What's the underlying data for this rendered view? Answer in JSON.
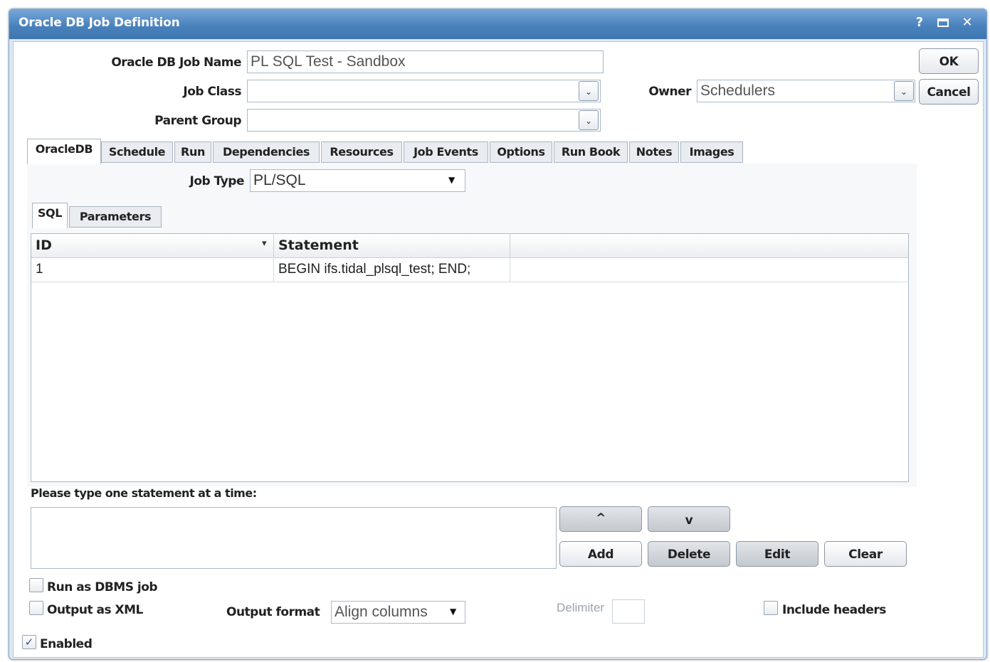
{
  "window": {
    "title": "Oracle DB Job Definition",
    "help_glyph": "?",
    "restore_glyph": "◘",
    "close_glyph": "✕"
  },
  "header": {
    "job_name_label": "Oracle DB Job Name",
    "job_name_value": "PL SQL Test - Sandbox",
    "job_class_label": "Job Class",
    "job_class_value": "",
    "parent_group_label": "Parent Group",
    "parent_group_value": "",
    "owner_label": "Owner",
    "owner_value": "Schedulers",
    "ok_label": "OK",
    "cancel_label": "Cancel",
    "dropdown_glyph": "⌄"
  },
  "tabs": [
    {
      "label": "OracleDB",
      "active": true
    },
    {
      "label": "Schedule"
    },
    {
      "label": "Run"
    },
    {
      "label": "Dependencies"
    },
    {
      "label": "Resources"
    },
    {
      "label": "Job Events"
    },
    {
      "label": "Options"
    },
    {
      "label": "Run Book"
    },
    {
      "label": "Notes"
    },
    {
      "label": "Images"
    }
  ],
  "oracle_tab": {
    "job_type_label": "Job Type",
    "job_type_value": "PL/SQL",
    "select_arrow": "▼",
    "subtabs": [
      {
        "label": "SQL",
        "active": true
      },
      {
        "label": "Parameters"
      }
    ],
    "grid": {
      "columns": [
        "ID",
        "Statement",
        ""
      ],
      "sort_glyph": "▾",
      "rows": [
        {
          "id": "1",
          "statement": "BEGIN ifs.tidal_plsql_test; END;"
        }
      ]
    },
    "statement_prompt": "Please type one statement at a time:",
    "statement_value": "",
    "buttons": {
      "up": "^",
      "down": "v",
      "add": "Add",
      "delete": "Delete",
      "edit": "Edit",
      "clear": "Clear"
    },
    "run_as_dbms_label": "Run as DBMS job",
    "run_as_dbms_checked": false,
    "output_xml_label": "Output as XML",
    "output_xml_checked": false,
    "output_format_label": "Output format",
    "output_format_value": "Align columns",
    "delimiter_label": "Delimiter",
    "delimiter_value": "",
    "include_headers_label": "Include headers",
    "include_headers_checked": false
  },
  "footer": {
    "enabled_label": "Enabled",
    "enabled_checked": true,
    "check_glyph": "✓"
  }
}
